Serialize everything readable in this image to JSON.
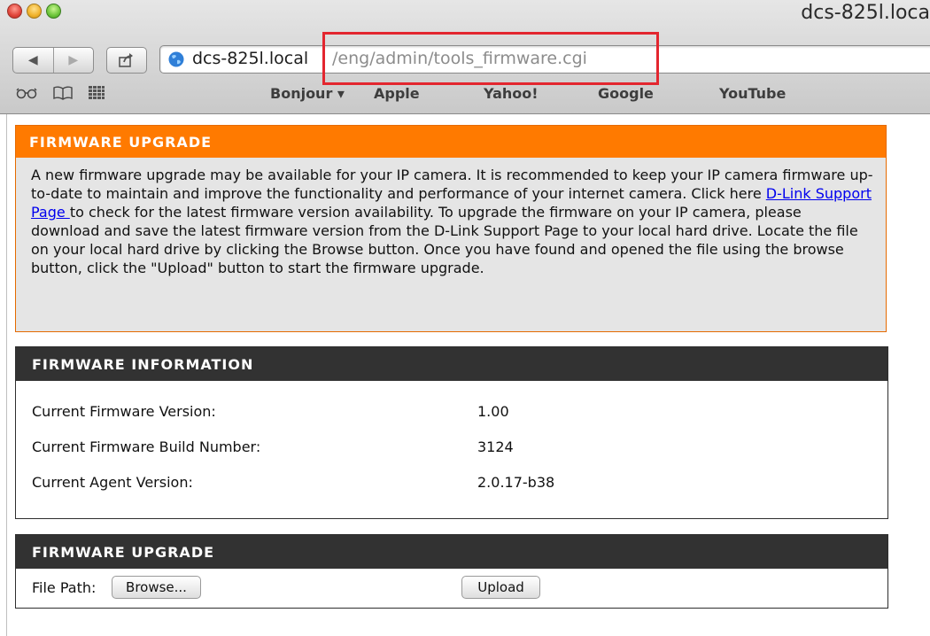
{
  "window": {
    "title": "dcs-825l.loca"
  },
  "browser": {
    "nav": {
      "back_icon": "◀",
      "forward_icon": "▶"
    },
    "url": {
      "host": "dcs-825l.local",
      "path": "/eng/admin/tools_firmware.cgi"
    },
    "bookmarks": [
      "Bonjour ▾",
      "Apple",
      "Yahoo!",
      "Google",
      "YouTube"
    ],
    "highlight_color": "#e3262f"
  },
  "notice": {
    "title": "FIRMWARE UPGRADE",
    "text_before_link": "A new firmware upgrade may be available for your IP camera. It is recommended to keep your IP camera firmware up-to-date to maintain and improve the functionality and performance of your internet camera. Click here ",
    "link_text": "D-Link Support Page ",
    "text_after_link": "to check for the latest firmware version availability. To upgrade the firmware on your IP camera, please download and save the latest firmware version from the D-Link Support Page to your local hard drive. Locate the file on your local hard drive by clicking the Browse button. Once you have found and opened the file using the browse button, click the \"Upload\" button to start the firmware upgrade.",
    "header_color": "#ff7a00"
  },
  "firmware_info": {
    "title": "FIRMWARE INFORMATION",
    "rows": [
      {
        "label": "Current Firmware Version:",
        "value": "1.00"
      },
      {
        "label": "Current Firmware Build Number:",
        "value": "3124"
      },
      {
        "label": "Current Agent Version:",
        "value": "2.0.17-b38"
      }
    ]
  },
  "upgrade": {
    "title": "FIRMWARE UPGRADE",
    "file_path_label": "File Path:",
    "browse_label": "Browse...",
    "upload_label": "Upload"
  }
}
